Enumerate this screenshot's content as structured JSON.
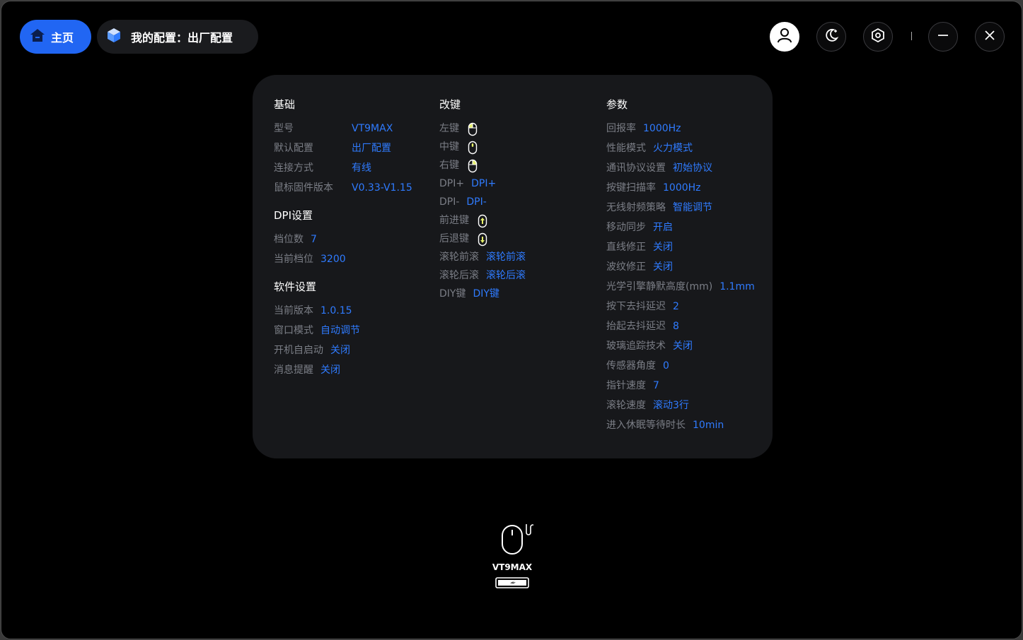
{
  "header": {
    "home_label": "主页",
    "profile_label": "我的配置：出厂配置",
    "icons": [
      "home-icon",
      "cube-icon",
      "user-icon",
      "moon-icon",
      "settings-icon",
      "minimize-icon",
      "close-icon"
    ]
  },
  "colors": {
    "accent": "#2166f3",
    "value": "#2f7bff",
    "label": "#7b7e86",
    "card": "#17181b",
    "background": "#000000",
    "key_highlight": "#e6f06a"
  },
  "basic": {
    "title": "基础",
    "rows": [
      {
        "label": "型号",
        "value": "VT9MAX"
      },
      {
        "label": "默认配置",
        "value": "出厂配置"
      },
      {
        "label": "连接方式",
        "value": "有线"
      },
      {
        "label": "鼠标固件版本",
        "value": "V0.33-V1.15"
      }
    ]
  },
  "dpi": {
    "title": "DPI设置",
    "rows": [
      {
        "label": "档位数",
        "value": "7"
      },
      {
        "label": "当前档位",
        "value": "3200"
      }
    ]
  },
  "software": {
    "title": "软件设置",
    "rows": [
      {
        "label": "当前版本",
        "value": "1.0.15"
      },
      {
        "label": "窗口模式",
        "value": "自动调节"
      },
      {
        "label": "开机自启动",
        "value": "关闭"
      },
      {
        "label": "消息提醒",
        "value": "关闭"
      }
    ]
  },
  "keys": {
    "title": "改键",
    "rows": [
      {
        "label": "左键",
        "value": "",
        "icon": "mouse-left-icon"
      },
      {
        "label": "中键",
        "value": "",
        "icon": "mouse-middle-icon"
      },
      {
        "label": "右键",
        "value": "",
        "icon": "mouse-right-icon"
      },
      {
        "label": "DPI+",
        "value": "DPI+"
      },
      {
        "label": "DPI-",
        "value": "DPI-"
      },
      {
        "label": "前进键",
        "value": "",
        "icon": "mouse-forward-icon"
      },
      {
        "label": "后退键",
        "value": "",
        "icon": "mouse-back-icon"
      },
      {
        "label": "滚轮前滚",
        "value": "滚轮前滚"
      },
      {
        "label": "滚轮后滚",
        "value": "滚轮后滚"
      },
      {
        "label": "DIY键",
        "value": "DIY键"
      }
    ]
  },
  "params": {
    "title": "参数",
    "rows": [
      {
        "label": "回报率",
        "value": "1000Hz"
      },
      {
        "label": "性能模式",
        "value": "火力模式"
      },
      {
        "label": "通讯协议设置",
        "value": "初始协议"
      },
      {
        "label": "按键扫描率",
        "value": "1000Hz"
      },
      {
        "label": "无线射频策略",
        "value": "智能调节"
      },
      {
        "label": "移动同步",
        "value": "开启"
      },
      {
        "label": "直线修正",
        "value": "关闭"
      },
      {
        "label": "波纹修正",
        "value": "关闭"
      },
      {
        "label": "光学引擎静默高度(mm)",
        "value": "1.1mm"
      },
      {
        "label": "按下去抖延迟",
        "value": "2"
      },
      {
        "label": "抬起去抖延迟",
        "value": "8"
      },
      {
        "label": "玻璃追踪技术",
        "value": "关闭"
      },
      {
        "label": "传感器角度",
        "value": "0"
      },
      {
        "label": "指针速度",
        "value": "7"
      },
      {
        "label": "滚轮速度",
        "value": "滚动3行"
      },
      {
        "label": "进入休眠等待时长",
        "value": "10min"
      }
    ]
  },
  "device": {
    "name": "VT9MAX",
    "icons": [
      "wired-mouse-icon",
      "battery-charging-icon"
    ]
  }
}
